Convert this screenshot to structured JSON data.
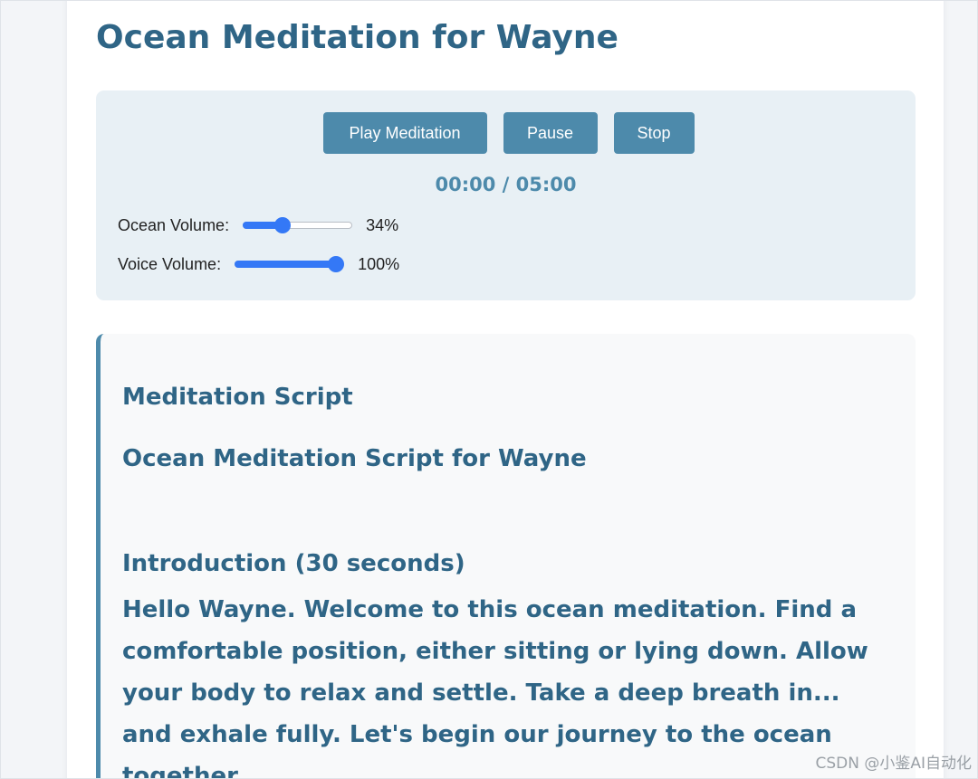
{
  "page": {
    "title": "Ocean Meditation for Wayne"
  },
  "player": {
    "play_label": "Play Meditation",
    "pause_label": "Pause",
    "stop_label": "Stop",
    "time_display": "00:00 / 05:00",
    "ocean_volume": {
      "label": "Ocean Volume:",
      "value_text": "34%",
      "level": 0.34
    },
    "voice_volume": {
      "label": "Voice Volume:",
      "value_text": "100%",
      "level": 1.0
    }
  },
  "script": {
    "heading": "Meditation Script",
    "subheading": "Ocean Meditation Script for Wayne",
    "section_title": "Introduction (30 seconds)",
    "section_text": "Hello Wayne. Welcome to this ocean meditation. Find a comfortable position, either sitting or lying down. Allow your body to relax and settle. Take a deep breath in... and exhale fully. Let's begin our journey to the ocean together."
  },
  "watermark": "CSDN @小鉴AI自动化",
  "colors": {
    "accent": "#4d8aab",
    "title": "#2f6586",
    "panel_bg": "#e8f0f5",
    "slider": "#3478f6"
  }
}
